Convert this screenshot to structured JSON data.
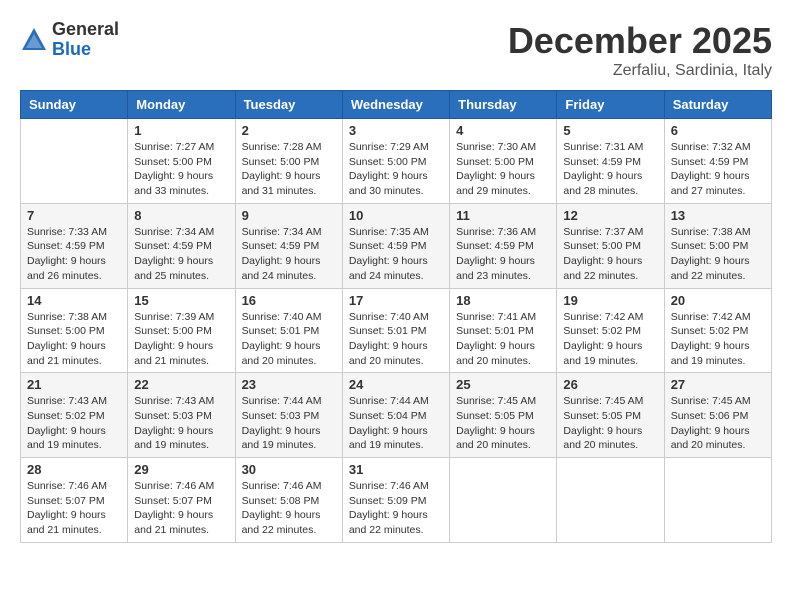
{
  "header": {
    "logo_general": "General",
    "logo_blue": "Blue",
    "month_title": "December 2025",
    "location": "Zerfaliu, Sardinia, Italy"
  },
  "days_of_week": [
    "Sunday",
    "Monday",
    "Tuesday",
    "Wednesday",
    "Thursday",
    "Friday",
    "Saturday"
  ],
  "weeks": [
    [
      {
        "day": "",
        "info": ""
      },
      {
        "day": "1",
        "info": "Sunrise: 7:27 AM\nSunset: 5:00 PM\nDaylight: 9 hours\nand 33 minutes."
      },
      {
        "day": "2",
        "info": "Sunrise: 7:28 AM\nSunset: 5:00 PM\nDaylight: 9 hours\nand 31 minutes."
      },
      {
        "day": "3",
        "info": "Sunrise: 7:29 AM\nSunset: 5:00 PM\nDaylight: 9 hours\nand 30 minutes."
      },
      {
        "day": "4",
        "info": "Sunrise: 7:30 AM\nSunset: 5:00 PM\nDaylight: 9 hours\nand 29 minutes."
      },
      {
        "day": "5",
        "info": "Sunrise: 7:31 AM\nSunset: 4:59 PM\nDaylight: 9 hours\nand 28 minutes."
      },
      {
        "day": "6",
        "info": "Sunrise: 7:32 AM\nSunset: 4:59 PM\nDaylight: 9 hours\nand 27 minutes."
      }
    ],
    [
      {
        "day": "7",
        "info": "Sunrise: 7:33 AM\nSunset: 4:59 PM\nDaylight: 9 hours\nand 26 minutes."
      },
      {
        "day": "8",
        "info": "Sunrise: 7:34 AM\nSunset: 4:59 PM\nDaylight: 9 hours\nand 25 minutes."
      },
      {
        "day": "9",
        "info": "Sunrise: 7:34 AM\nSunset: 4:59 PM\nDaylight: 9 hours\nand 24 minutes."
      },
      {
        "day": "10",
        "info": "Sunrise: 7:35 AM\nSunset: 4:59 PM\nDaylight: 9 hours\nand 24 minutes."
      },
      {
        "day": "11",
        "info": "Sunrise: 7:36 AM\nSunset: 4:59 PM\nDaylight: 9 hours\nand 23 minutes."
      },
      {
        "day": "12",
        "info": "Sunrise: 7:37 AM\nSunset: 5:00 PM\nDaylight: 9 hours\nand 22 minutes."
      },
      {
        "day": "13",
        "info": "Sunrise: 7:38 AM\nSunset: 5:00 PM\nDaylight: 9 hours\nand 22 minutes."
      }
    ],
    [
      {
        "day": "14",
        "info": "Sunrise: 7:38 AM\nSunset: 5:00 PM\nDaylight: 9 hours\nand 21 minutes."
      },
      {
        "day": "15",
        "info": "Sunrise: 7:39 AM\nSunset: 5:00 PM\nDaylight: 9 hours\nand 21 minutes."
      },
      {
        "day": "16",
        "info": "Sunrise: 7:40 AM\nSunset: 5:01 PM\nDaylight: 9 hours\nand 20 minutes."
      },
      {
        "day": "17",
        "info": "Sunrise: 7:40 AM\nSunset: 5:01 PM\nDaylight: 9 hours\nand 20 minutes."
      },
      {
        "day": "18",
        "info": "Sunrise: 7:41 AM\nSunset: 5:01 PM\nDaylight: 9 hours\nand 20 minutes."
      },
      {
        "day": "19",
        "info": "Sunrise: 7:42 AM\nSunset: 5:02 PM\nDaylight: 9 hours\nand 19 minutes."
      },
      {
        "day": "20",
        "info": "Sunrise: 7:42 AM\nSunset: 5:02 PM\nDaylight: 9 hours\nand 19 minutes."
      }
    ],
    [
      {
        "day": "21",
        "info": "Sunrise: 7:43 AM\nSunset: 5:02 PM\nDaylight: 9 hours\nand 19 minutes."
      },
      {
        "day": "22",
        "info": "Sunrise: 7:43 AM\nSunset: 5:03 PM\nDaylight: 9 hours\nand 19 minutes."
      },
      {
        "day": "23",
        "info": "Sunrise: 7:44 AM\nSunset: 5:03 PM\nDaylight: 9 hours\nand 19 minutes."
      },
      {
        "day": "24",
        "info": "Sunrise: 7:44 AM\nSunset: 5:04 PM\nDaylight: 9 hours\nand 19 minutes."
      },
      {
        "day": "25",
        "info": "Sunrise: 7:45 AM\nSunset: 5:05 PM\nDaylight: 9 hours\nand 20 minutes."
      },
      {
        "day": "26",
        "info": "Sunrise: 7:45 AM\nSunset: 5:05 PM\nDaylight: 9 hours\nand 20 minutes."
      },
      {
        "day": "27",
        "info": "Sunrise: 7:45 AM\nSunset: 5:06 PM\nDaylight: 9 hours\nand 20 minutes."
      }
    ],
    [
      {
        "day": "28",
        "info": "Sunrise: 7:46 AM\nSunset: 5:07 PM\nDaylight: 9 hours\nand 21 minutes."
      },
      {
        "day": "29",
        "info": "Sunrise: 7:46 AM\nSunset: 5:07 PM\nDaylight: 9 hours\nand 21 minutes."
      },
      {
        "day": "30",
        "info": "Sunrise: 7:46 AM\nSunset: 5:08 PM\nDaylight: 9 hours\nand 22 minutes."
      },
      {
        "day": "31",
        "info": "Sunrise: 7:46 AM\nSunset: 5:09 PM\nDaylight: 9 hours\nand 22 minutes."
      },
      {
        "day": "",
        "info": ""
      },
      {
        "day": "",
        "info": ""
      },
      {
        "day": "",
        "info": ""
      }
    ]
  ]
}
